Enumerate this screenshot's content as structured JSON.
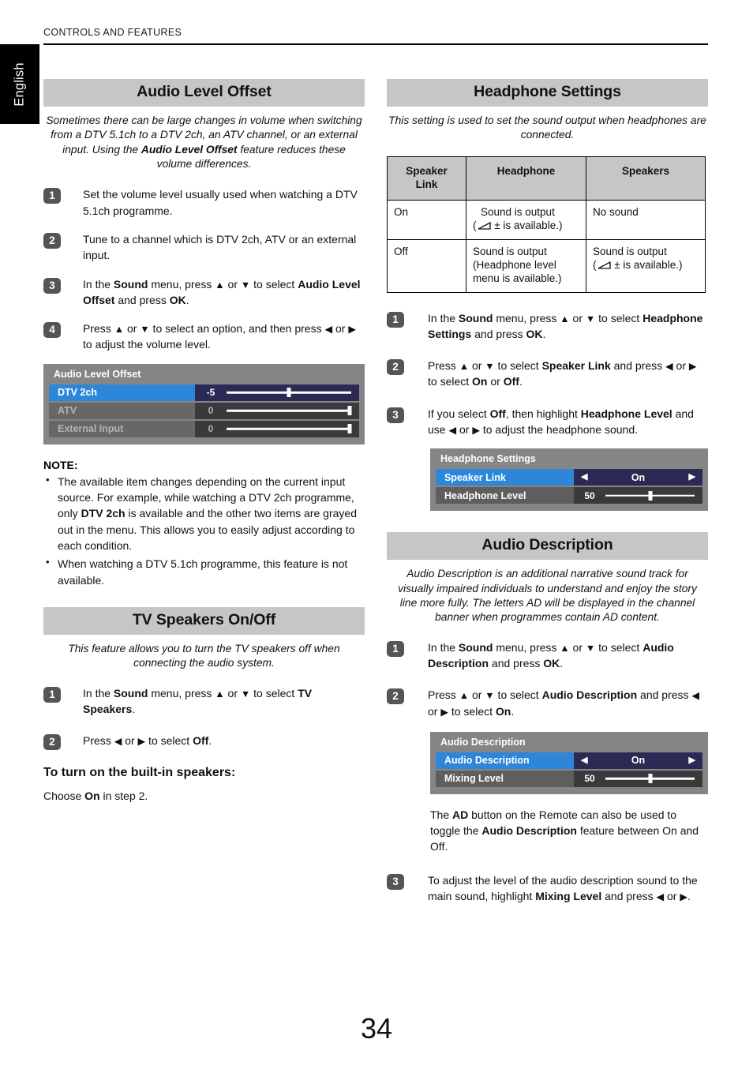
{
  "running_header": "CONTROLS AND FEATURES",
  "language_tab": "English",
  "page_number": "34",
  "left_column": {
    "audio_level_offset": {
      "heading": "Audio Level Offset",
      "blurb_1": "Sometimes there can be large changes in volume when switching from a DTV 5.1ch to a DTV 2ch, an ATV channel, or an external input. Using the ",
      "blurb_bold": "Audio Level Offset",
      "blurb_2": " feature reduces these volume differences.",
      "steps": [
        {
          "num": "1",
          "text": "Set the volume level usually used when watching a DTV 5.1ch programme."
        },
        {
          "num": "2",
          "text": "Tune to a channel which is DTV 2ch, ATV or an external input."
        },
        {
          "num": "3",
          "text": "In the Sound menu, press ▲ or ▼ to select Audio Level Offset and press OK."
        },
        {
          "num": "4",
          "text": "Press ▲ or ▼ to select an option, and then press ◀ or ▶ to adjust the volume level."
        }
      ],
      "osd": {
        "title": "Audio Level Offset",
        "rows": [
          {
            "label": "DTV 2ch",
            "value": "-5",
            "state": "selected",
            "thumb_percent": 50
          },
          {
            "label": "ATV",
            "value": "0",
            "state": "dimmed",
            "thumb_percent": 99
          },
          {
            "label": "External Input",
            "value": "0",
            "state": "dimmed",
            "thumb_percent": 99
          }
        ]
      },
      "note_title": "NOTE:",
      "notes": [
        "The available item changes depending on the current input source. For example, while watching a DTV 2ch programme, only DTV 2ch is available and the other two items are grayed out in the menu. This allows you to easily adjust according to each condition.",
        "When watching a DTV 5.1ch programme, this feature is not available."
      ]
    },
    "tv_speakers": {
      "heading": "TV Speakers On/Off",
      "blurb": "This feature allows you to turn the TV speakers off when connecting the audio system.",
      "steps": [
        {
          "num": "1",
          "text": "In the Sound menu, press ▲ or ▼ to select TV Speakers."
        },
        {
          "num": "2",
          "text": "Press ◀ or ▶ to select Off."
        }
      ],
      "subhead": "To turn on the built-in speakers:",
      "closing": "Choose On in step 2."
    }
  },
  "right_column": {
    "headphone_settings": {
      "heading": "Headphone Settings",
      "blurb": "This setting is used to set the sound output when headphones are connected.",
      "table": {
        "headers": [
          "Speaker Link",
          "Headphone",
          "Speakers"
        ],
        "rows": [
          {
            "speaker_link": "On",
            "headphone": "Sound is output (∠ ± is available.)",
            "headphone_line1": "Sound is output",
            "headphone_line2_pre": "(",
            "headphone_line2_post": " ± is available.)",
            "speakers": "No sound",
            "speakers_has_icon": false
          },
          {
            "speaker_link": "Off",
            "headphone": "Sound is output (Headphone level menu is available.)",
            "headphone_line1": "Sound is output",
            "headphone_line2_pre": "(Headphone level",
            "headphone_line2_post": "menu is available.)",
            "speakers": "Sound is output",
            "speakers_line2_pre": "(",
            "speakers_line2_post": " ± is available.)",
            "speakers_has_icon": true
          }
        ]
      },
      "steps": [
        {
          "num": "1",
          "text": "In the Sound menu, press ▲ or ▼ to select Headphone Settings and press OK."
        },
        {
          "num": "2",
          "text": "Press ▲ or ▼ to select Speaker Link and press ◀ or ▶ to select On or Off."
        },
        {
          "num": "3",
          "text": "If you select Off, then highlight Headphone Level and use ◀ or ▶ to adjust the headphone sound."
        }
      ],
      "osd": {
        "title": "Headphone Settings",
        "rows": [
          {
            "label": "Speaker Link",
            "value": "On",
            "type": "option",
            "state": "selected"
          },
          {
            "label": "Headphone Level",
            "value": "50",
            "type": "slider",
            "state": "normal",
            "thumb_percent": 50
          }
        ]
      }
    },
    "audio_description": {
      "heading": "Audio Description",
      "blurb": "Audio Description is an additional narrative sound track for visually impaired individuals to understand and enjoy the story line more fully. The letters AD will be displayed in the channel banner when programmes contain AD content.",
      "steps": [
        {
          "num": "1",
          "text": "In the Sound menu, press ▲ or ▼ to select Audio Description and press OK."
        },
        {
          "num": "2",
          "text": "Press ▲ or ▼ to select Audio Description and press ◀ or ▶ to select On."
        }
      ],
      "osd": {
        "title": "Audio Description",
        "rows": [
          {
            "label": "Audio Description",
            "value": "On",
            "type": "option",
            "state": "selected"
          },
          {
            "label": "Mixing Level",
            "value": "50",
            "type": "slider",
            "state": "normal",
            "thumb_percent": 50
          }
        ]
      },
      "remote_note": "The AD button on the Remote can also be used to toggle the Audio Description feature between On and Off.",
      "step3": {
        "num": "3",
        "text": "To adjust the level of the audio description sound to the main sound, highlight Mixing Level and press ◀ or ▶."
      }
    }
  },
  "colors": {
    "section_header_bg": "#c6c6c6",
    "osd_bg": "#858585",
    "osd_highlight": "#2e86d8",
    "osd_value_selected": "#2a2a55",
    "tab_bg": "#000000"
  }
}
